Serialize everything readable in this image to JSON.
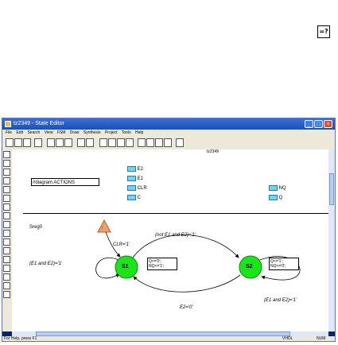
{
  "corner_button": {
    "label": "=?"
  },
  "window": {
    "title": "tz2349 - State Editor",
    "menu": [
      "File",
      "Edit",
      "Search",
      "View",
      "FSM",
      "Draw",
      "Synthesis",
      "Project",
      "Tools",
      "Help"
    ]
  },
  "diagram": {
    "filename": "tz2349",
    "actions_label": "//diagram ACTIONS",
    "inputs": [
      "E2",
      "E1",
      "CLR",
      "C"
    ],
    "outputs": [
      "NQ",
      "Q"
    ],
    "region_name": "Sreg0",
    "reset_condition": "CLR='1'",
    "states": [
      {
        "name": "S1",
        "actions": [
          "Q<='0';",
          "NQ<='1';"
        ]
      },
      {
        "name": "S2",
        "actions": [
          "Q<='1';",
          "NQ<='0';"
        ]
      }
    ],
    "transitions": {
      "s1_to_s2": "(not E1 and E2)='1'",
      "s2_to_s1": "E2='0'",
      "s1_loop": "(E1 and E2)='1'",
      "s2_loop": "(E1 and E2)='1'"
    }
  },
  "status": {
    "hint": "For Help, press F1",
    "mode": "VHDL",
    "num": "NUM"
  },
  "colors": {
    "state_fill": "#19e619",
    "reset_triangle": "#f0a070",
    "port": "#68d8f8",
    "title_bar": "#2a5cc8"
  }
}
